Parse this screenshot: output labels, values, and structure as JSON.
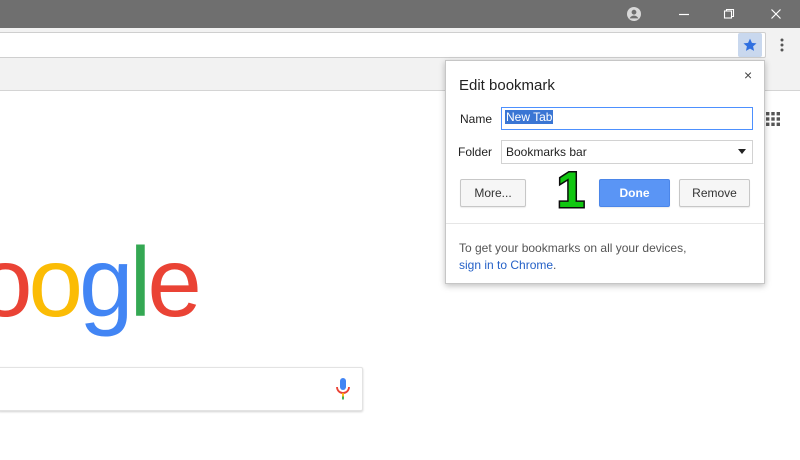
{
  "browser": {
    "window_controls": [
      "profile-icon",
      "minimize-icon",
      "restore-icon",
      "close-icon"
    ],
    "toolbar": {
      "bookmark_star_icon": "star-icon",
      "menu_icon": "kebab-menu-icon"
    }
  },
  "page": {
    "logo_letters": [
      {
        "ch": "o",
        "color": "#EA4335"
      },
      {
        "ch": "o",
        "color": "#FBBC05"
      },
      {
        "ch": "g",
        "color": "#4285F4"
      },
      {
        "ch": "l",
        "color": "#34A853"
      },
      {
        "ch": "e",
        "color": "#EA4335"
      }
    ],
    "mic_icon": "microphone-icon",
    "apps_icon": "apps-grid-icon"
  },
  "dialog": {
    "title": "Edit bookmark",
    "close_glyph": "×",
    "name_label": "Name",
    "name_value": "New Tab",
    "folder_label": "Folder",
    "folder_value": "Bookmarks bar",
    "more_button": "More...",
    "done_button": "Done",
    "remove_button": "Remove",
    "sync_note": "To get your bookmarks on all your devices,",
    "sync_link": "sign in to Chrome",
    "sync_link_suffix": "."
  },
  "annotation": {
    "step": "1",
    "color": "#11C711"
  }
}
